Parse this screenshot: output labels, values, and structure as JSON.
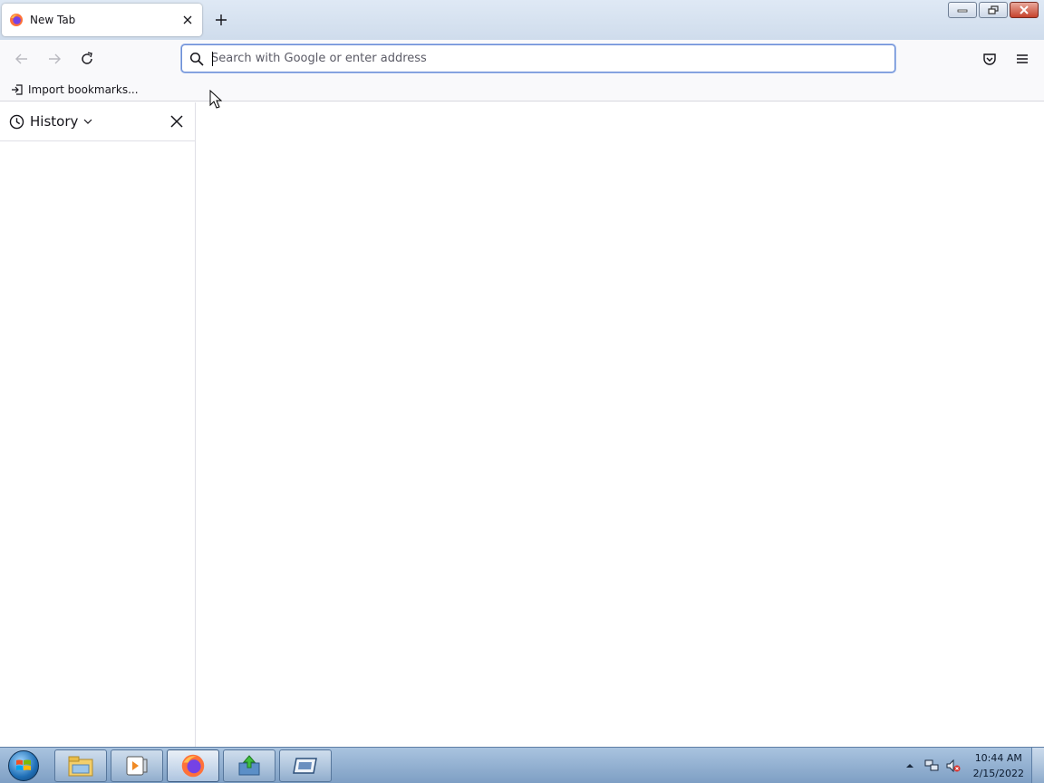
{
  "tabs": [
    {
      "title": "New Tab",
      "icon": "firefox-icon"
    }
  ],
  "navigation": {
    "back_icon": "arrow-left-icon",
    "forward_icon": "arrow-right-icon",
    "reload_icon": "reload-icon",
    "urlbar": {
      "placeholder": "Search with Google or enter address",
      "value": ""
    },
    "pocket_icon": "pocket-icon",
    "menu_icon": "hamburger-menu-icon"
  },
  "bookmarks_bar": {
    "import_label": "Import bookmarks..."
  },
  "sidebar": {
    "title": "History",
    "icon": "clock-icon"
  },
  "taskbar": {
    "apps": [
      "file-explorer",
      "media-player",
      "firefox",
      "installer",
      "card-app"
    ],
    "clock_time": "10:44 AM",
    "clock_date": "2/15/2022"
  },
  "colors": {
    "accent": "#6c8ed6",
    "taskbar": "#7e9fc4"
  }
}
